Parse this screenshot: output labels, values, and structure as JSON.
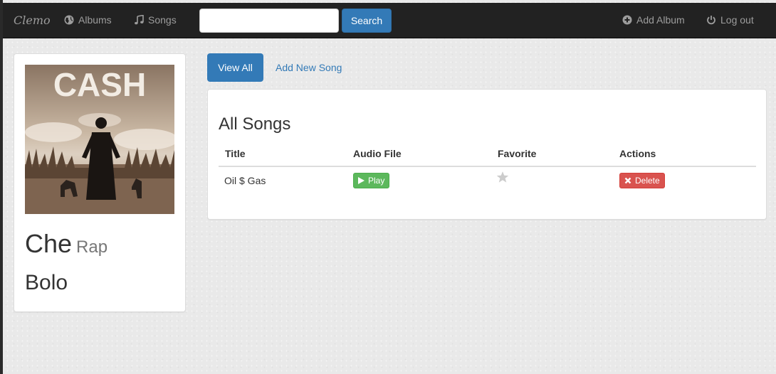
{
  "navbar": {
    "brand": "Clemo",
    "albums_label": "Albums",
    "songs_label": "Songs",
    "search": {
      "value": "",
      "placeholder": ""
    },
    "search_button": "Search",
    "add_album_label": "Add Album",
    "logout_label": "Log out"
  },
  "album": {
    "title": "Che",
    "genre": "Rap",
    "artist": "Bolo",
    "cover": {
      "text": "CASH"
    }
  },
  "tabs": {
    "view_all": "View All",
    "add_new_song": "Add New Song"
  },
  "songs": {
    "heading": "All Songs",
    "columns": [
      "Title",
      "Audio File",
      "Favorite",
      "Actions"
    ],
    "rows": [
      {
        "title": "Oil $ Gas",
        "play_label": "Play",
        "favorite": false,
        "delete_label": "Delete"
      }
    ]
  },
  "colors": {
    "primary": "#337ab7",
    "success": "#5cb85c",
    "danger": "#d9534f",
    "navbar": "#222222",
    "star_inactive": "#cccccc"
  }
}
